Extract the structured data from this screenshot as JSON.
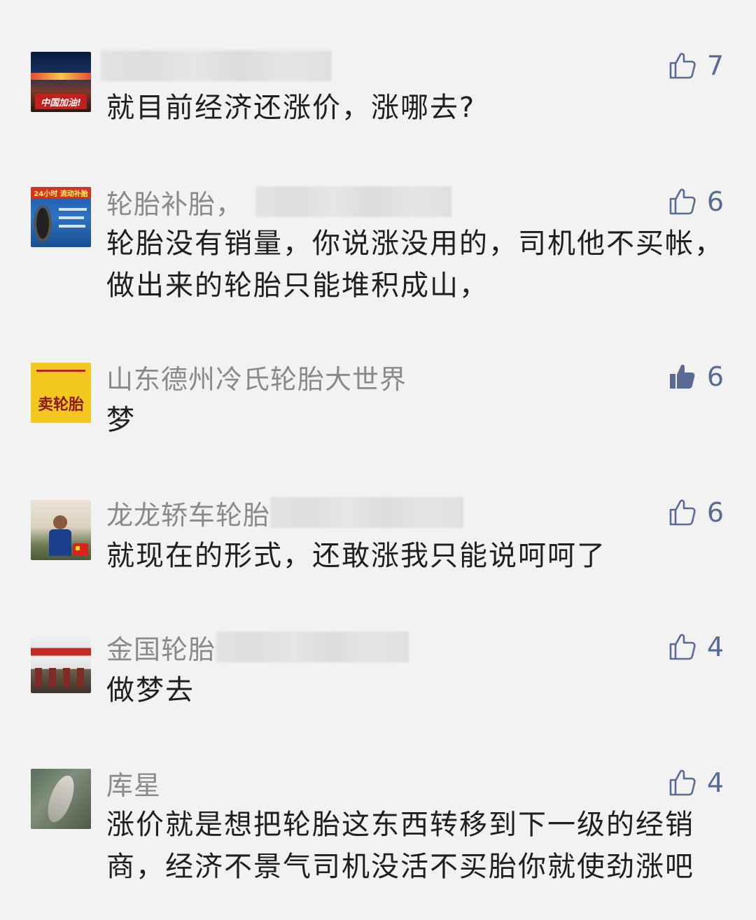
{
  "accent_color": "#576b95",
  "comments": [
    {
      "username": "",
      "text": "就目前经济还涨价，涨哪去?",
      "likes": "7",
      "liked": false,
      "avatar_caption": "中国加油!"
    },
    {
      "username": "轮胎补胎，",
      "text": "轮胎没有销量，你说涨没用的，司机他不买帐，做出来的轮胎只能堆积成山，",
      "likes": "6",
      "liked": false,
      "avatar_caption": "24小时 流动补胎"
    },
    {
      "username": "山东德州冷氏轮胎大世界",
      "text": "梦",
      "likes": "6",
      "liked": true,
      "avatar_caption": "卖轮胎"
    },
    {
      "username": "龙龙轿车轮胎",
      "text": "就现在的形式，还敢涨我只能说呵呵了",
      "likes": "6",
      "liked": false,
      "avatar_caption": ""
    },
    {
      "username": "金国轮胎",
      "text": "做梦去",
      "likes": "4",
      "liked": false,
      "avatar_caption": ""
    },
    {
      "username": "库星",
      "text": "涨价就是想把轮胎这东西转移到下一级的经销商，经济不景气司机没活不买胎你就使劲涨吧",
      "likes": "4",
      "liked": false,
      "avatar_caption": ""
    }
  ]
}
